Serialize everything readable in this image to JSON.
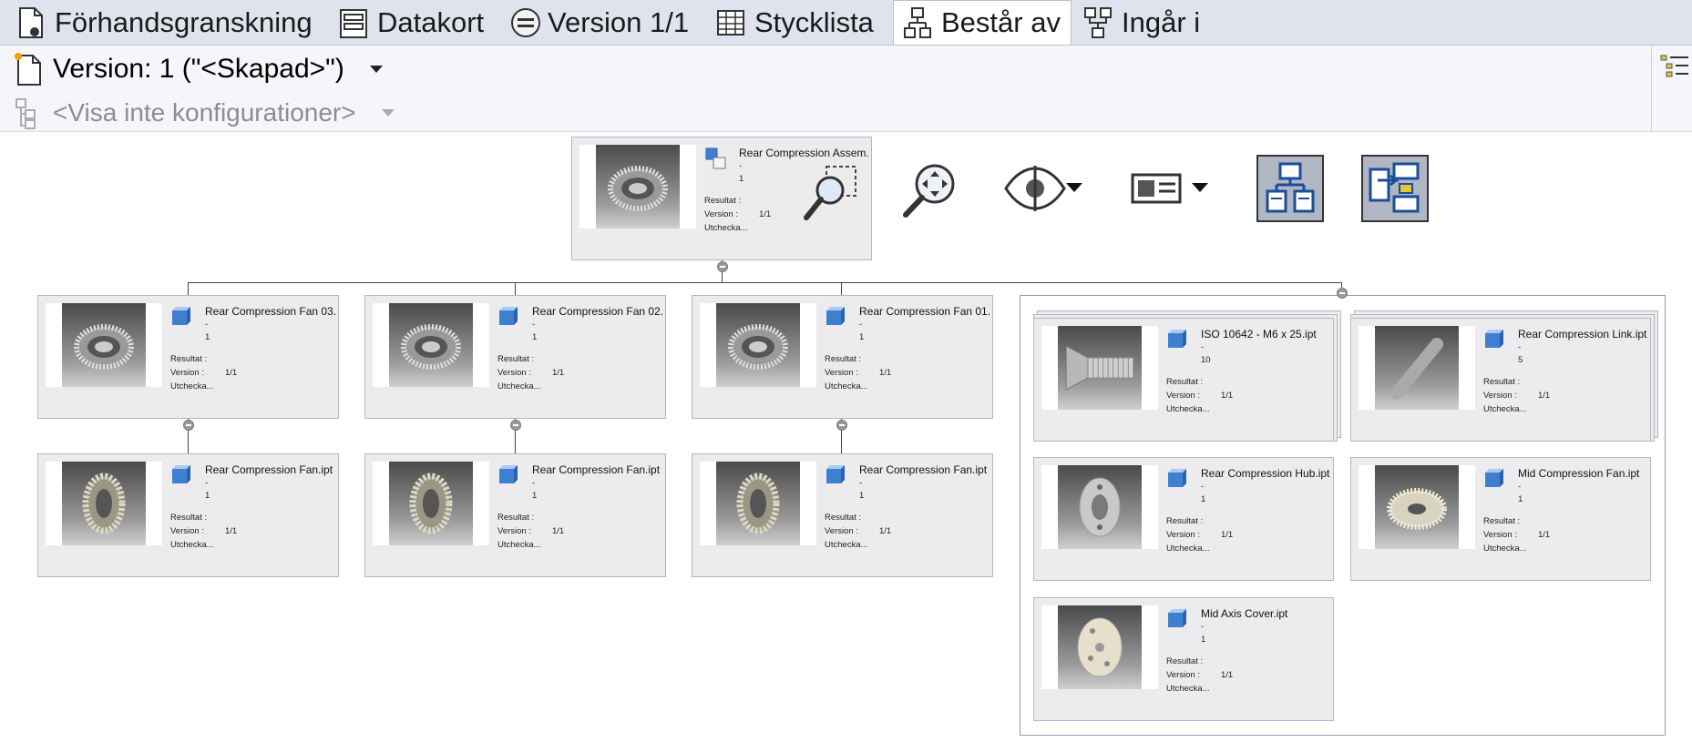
{
  "tabs": [
    {
      "label": "Förhandsgranskning",
      "icon": "page-preview-icon"
    },
    {
      "label": "Datakort",
      "icon": "datacard-icon"
    },
    {
      "label": "Version 1/1",
      "icon": "version-icon"
    },
    {
      "label": "Stycklista",
      "icon": "table-icon"
    },
    {
      "label": "Består av",
      "icon": "hierarchy-down-icon",
      "active": true
    },
    {
      "label": "Ingår i",
      "icon": "hierarchy-up-icon"
    }
  ],
  "header": {
    "version_label": "Version: 1 (\"<Skapad>\")",
    "config_placeholder": "<Visa inte konfigurationer>"
  },
  "labels": {
    "resultat": "Resultat :",
    "version": "Version :",
    "utcheckad": "Utchecka..."
  },
  "root": {
    "name": "Rear Compression Assem...",
    "dash": "-",
    "qty": "1",
    "version": "1/1"
  },
  "level1": [
    {
      "name": "Rear Compression Fan 03...",
      "dash": "-",
      "qty": "1",
      "version": "1/1"
    },
    {
      "name": "Rear Compression Fan 02...",
      "dash": "-",
      "qty": "1",
      "version": "1/1"
    },
    {
      "name": "Rear Compression Fan 01...",
      "dash": "-",
      "qty": "1",
      "version": "1/1"
    }
  ],
  "level2": [
    {
      "name": "Rear Compression Fan.ipt",
      "dash": "-",
      "qty": "1",
      "version": "1/1"
    },
    {
      "name": "Rear Compression Fan.ipt",
      "dash": "-",
      "qty": "1",
      "version": "1/1"
    },
    {
      "name": "Rear Compression Fan.ipt",
      "dash": "-",
      "qty": "1",
      "version": "1/1"
    }
  ],
  "group": [
    {
      "name": "ISO 10642 - M6 x  25.ipt",
      "dash": "-",
      "qty": "10",
      "version": "1/1"
    },
    {
      "name": "Rear Compression Link.ipt",
      "dash": "-",
      "qty": "5",
      "version": "1/1"
    },
    {
      "name": "Rear Compression Hub.ipt",
      "dash": "-",
      "qty": "1",
      "version": "1/1"
    },
    {
      "name": "Mid Compression Fan.ipt",
      "dash": "-",
      "qty": "1",
      "version": "1/1"
    },
    {
      "name": "Mid Axis Cover.ipt",
      "dash": "-",
      "qty": "1",
      "version": "1/1"
    }
  ],
  "toolbar": [
    "zoom-region-icon",
    "zoom-pan-icon",
    "visibility-eye-icon",
    "card-view-icon",
    "layout-tree-icon",
    "layout-expand-icon"
  ],
  "colors": {
    "tabbar": "#dfe3ed",
    "node": "#ececee",
    "cube": "#3f7fd0"
  }
}
